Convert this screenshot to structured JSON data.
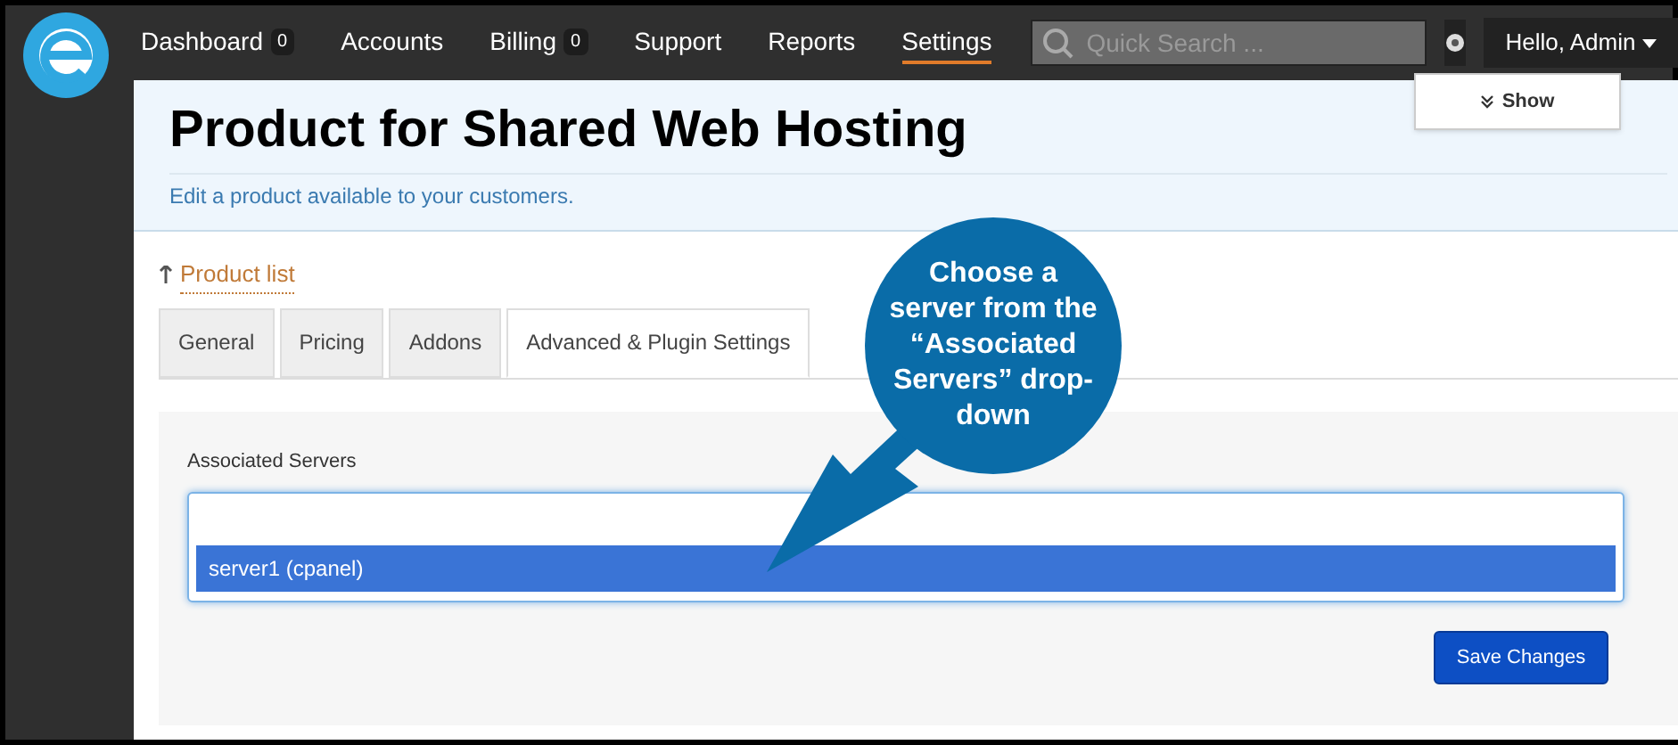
{
  "nav": {
    "items": [
      {
        "label": "Dashboard",
        "count": "0",
        "selected": false
      },
      {
        "label": "Accounts",
        "selected": false
      },
      {
        "label": "Billing",
        "count": "0",
        "selected": false
      },
      {
        "label": "Support",
        "selected": false
      },
      {
        "label": "Reports",
        "selected": false
      },
      {
        "label": "Settings",
        "selected": true
      }
    ],
    "search": {
      "placeholder": "Quick Search ..."
    },
    "user_menu": "Hello, Admin"
  },
  "header": {
    "title": "Product for Shared Web Hosting",
    "subtitle": "Edit a product available to your customers.",
    "show_button": "Show"
  },
  "back_link": "Product list",
  "tabs": [
    {
      "label": "General",
      "selected": false
    },
    {
      "label": "Pricing",
      "selected": false
    },
    {
      "label": "Addons",
      "selected": false
    },
    {
      "label": "Advanced & Plugin Settings",
      "selected": true
    }
  ],
  "form": {
    "field_label": "Associated Servers",
    "options": [
      {
        "label": "server1 (cpanel)",
        "selected": true
      }
    ],
    "save_button": "Save Changes"
  },
  "callout": "Choose a server from the “Associated Servers” drop-down"
}
